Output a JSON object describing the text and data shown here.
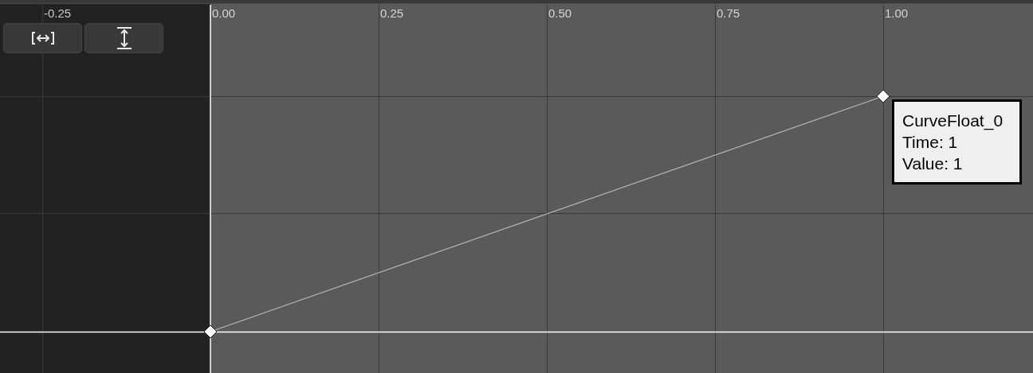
{
  "time_ticks": [
    "-0.25",
    "0.00",
    "0.25",
    "0.50",
    "0.75",
    "1.00"
  ],
  "toolbar": [
    {
      "kind": "fit_horizontal"
    },
    {
      "kind": "fit_vertical"
    }
  ],
  "tooltip": {
    "name": "CurveFloat_0",
    "time": "Time: 1",
    "value": "Value: 1"
  }
}
